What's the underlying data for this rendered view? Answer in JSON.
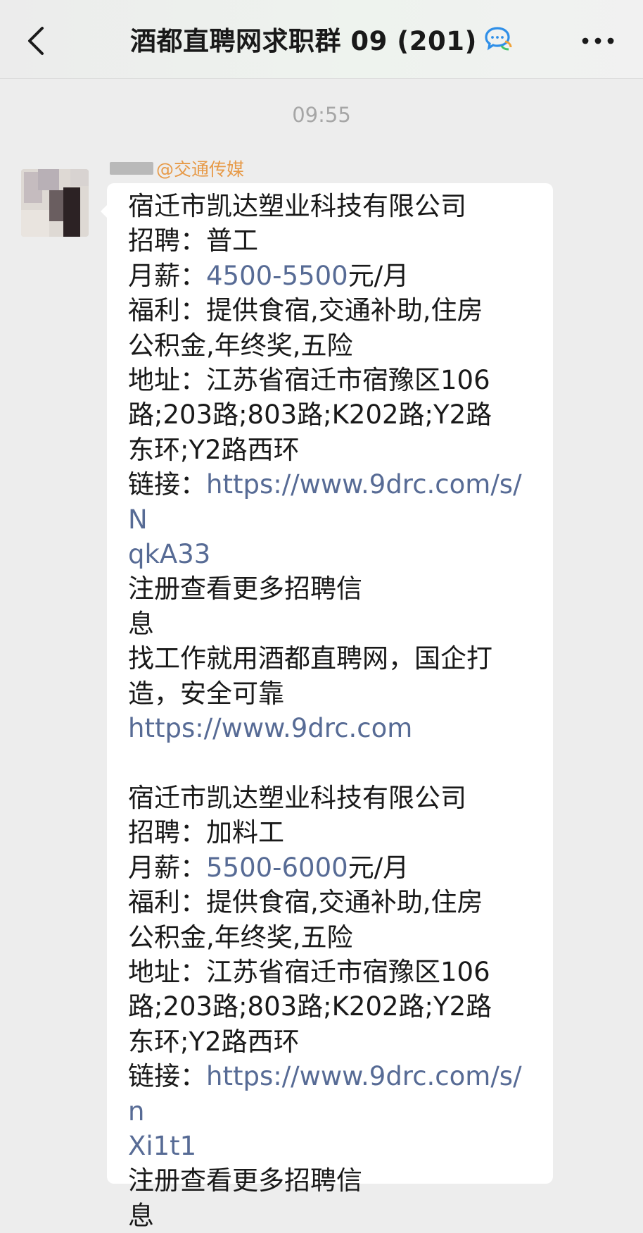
{
  "header": {
    "title": "酒都直聘网求职群 09 (201)",
    "back_icon": "chevron-left-icon",
    "chat_icon": "group-chat-icon",
    "more_icon": "more-dots-icon"
  },
  "chat": {
    "timestamp": "09:55",
    "sender_tag": "@交通传媒",
    "message": {
      "post1": {
        "company": "宿迁市凯达塑业科技有限公司",
        "job": "招聘：普工",
        "salary_label": "月薪：",
        "salary_value": "4500-5500",
        "salary_unit": "元/月",
        "benefits_1": "福利：提供食宿,交通补助,住房",
        "benefits_2": "公积金,年终奖,五险",
        "address_1": "地址：江苏省宿迁市宿豫区106",
        "address_2": "路;203路;803路;K202路;Y2路",
        "address_3": "东环;Y2路西环",
        "link_label": "链接：",
        "link_1": "https://www.9drc.com/s/N",
        "link_2": "qkA33",
        "register_1": "注册查看更多招聘信",
        "register_2": "息",
        "slogan_1": "找工作就用酒都直聘网，国企打",
        "slogan_2": "造，安全可靠",
        "site_link": "https://www.9drc.com"
      },
      "post2": {
        "company": "宿迁市凯达塑业科技有限公司",
        "job": "招聘：加料工",
        "salary_label": "月薪：",
        "salary_value": "5500-6000",
        "salary_unit": "元/月",
        "benefits_1": "福利：提供食宿,交通补助,住房",
        "benefits_2": "公积金,年终奖,五险",
        "address_1": "地址：江苏省宿迁市宿豫区106",
        "address_2": "路;203路;803路;K202路;Y2路",
        "address_3": "东环;Y2路西环",
        "link_label": "链接：",
        "link_1": "https://www.9drc.com/s/n",
        "link_2": "Xi1t1",
        "register_1": "注册查看更多招聘信",
        "register_2": "息"
      }
    }
  },
  "colors": {
    "link": "#576b95",
    "sender_tag": "#e79a48",
    "timestamp": "#a6a6a6",
    "background": "#ededed"
  }
}
